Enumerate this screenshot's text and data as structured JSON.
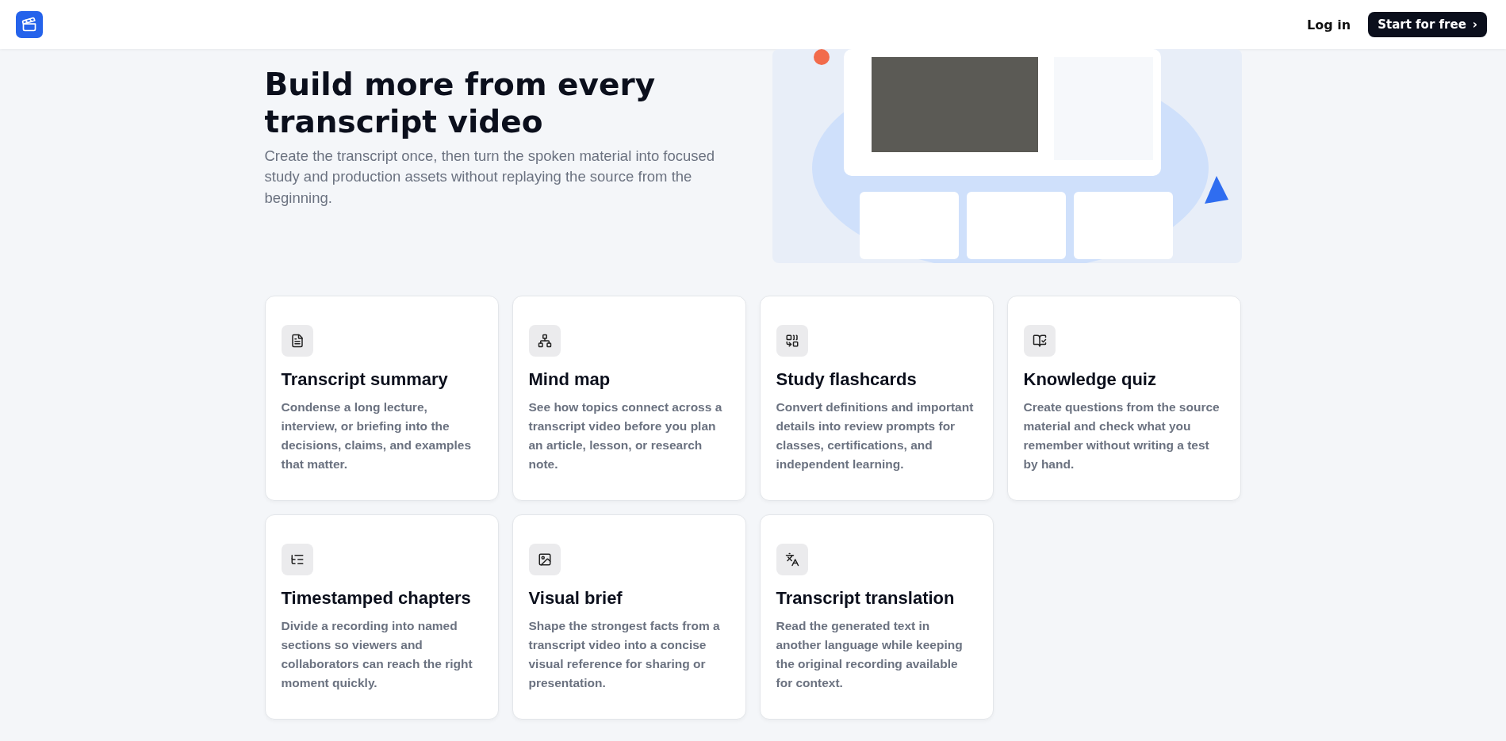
{
  "header": {
    "login": "Log in",
    "cta": "Start for free",
    "cta_caret": "›"
  },
  "hero": {
    "title": "Build more from every transcript video",
    "subtitle": "Create the transcript once, then turn the spoken material into focused study and production assets without replaying the source from the beginning."
  },
  "features": [
    {
      "kind": "summary",
      "title": "Transcript summary",
      "text": "Condense a long lecture, interview, or briefing into the decisions, claims, and examples that matter."
    },
    {
      "kind": "mindmap",
      "title": "Mind map",
      "text": "See how topics connect across a transcript video before you plan an article, lesson, or research note."
    },
    {
      "kind": "flashcards",
      "title": "Study flashcards",
      "text": "Convert definitions and important details into review prompts for classes, certifications, and independent learning."
    },
    {
      "kind": "quiz",
      "title": "Knowledge quiz",
      "text": "Create questions from the source material and check what you remember without writing a test by hand."
    },
    {
      "kind": "chapters",
      "title": "Timestamped chapters",
      "text": "Divide a recording into named sections so viewers and collaborators can reach the right moment quickly."
    },
    {
      "kind": "visual",
      "title": "Visual brief",
      "text": "Shape the strongest facts from a transcript video into a concise visual reference for sharing or presentation."
    },
    {
      "kind": "translation",
      "title": "Transcript translation",
      "text": "Read the generated text in another language while keeping the original recording available for context."
    }
  ]
}
